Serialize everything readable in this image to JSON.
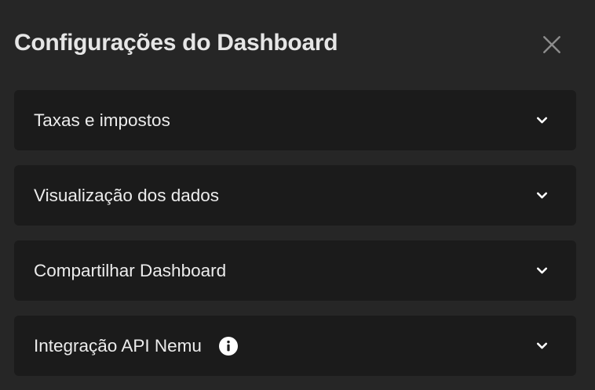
{
  "modal": {
    "title": "Configurações do Dashboard",
    "close_icon": "close-icon"
  },
  "sections": [
    {
      "label": "Taxas e impostos",
      "icon": "chevron-down-icon"
    },
    {
      "label": "Visualização dos dados",
      "icon": "chevron-down-icon"
    },
    {
      "label": "Compartilhar Dashboard",
      "icon": "chevron-down-icon"
    },
    {
      "label": "Integração API Nemu",
      "icon": "chevron-down-icon",
      "info_icon": "info-icon"
    }
  ],
  "colors": {
    "background": "#262626",
    "panel": "#1b1b1b",
    "text": "#ececec",
    "close": "#8c8c8c"
  }
}
